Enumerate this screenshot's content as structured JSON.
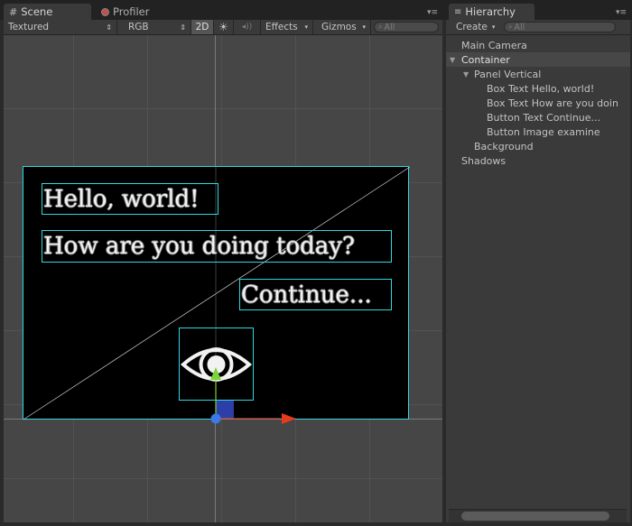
{
  "scene_tabs": [
    {
      "label": "Scene",
      "icon": "grid-icon",
      "active": true
    },
    {
      "label": "Profiler",
      "icon": "profiler-icon",
      "active": false
    }
  ],
  "scene_toolbar": {
    "shading_mode": "Textured",
    "render_mode": "RGB",
    "view_mode": "2D",
    "lighting_icon": "sun-icon",
    "audio_icon": "speaker-icon",
    "effects_label": "Effects",
    "gizmos_label": "Gizmos",
    "search_placeholder": "All"
  },
  "scene_content": {
    "hello_text": "Hello, world!",
    "question_text": "How are you doing today?",
    "continue_text": "Continue...",
    "image_icon": "eye-icon"
  },
  "hierarchy": {
    "tab_label": "Hierarchy",
    "create_label": "Create",
    "search_placeholder": "All",
    "items": [
      {
        "label": "Main Camera",
        "depth": 0,
        "expandable": false
      },
      {
        "label": "Container",
        "depth": 0,
        "expandable": true,
        "selected": true
      },
      {
        "label": "Panel Vertical",
        "depth": 1,
        "expandable": true
      },
      {
        "label": "Box Text Hello, world!",
        "depth": 2,
        "expandable": false
      },
      {
        "label": "Box Text How are you doin",
        "depth": 2,
        "expandable": false
      },
      {
        "label": "Button Text Continue...",
        "depth": 2,
        "expandable": false
      },
      {
        "label": "Button Image examine",
        "depth": 2,
        "expandable": false
      },
      {
        "label": "Background",
        "depth": 1,
        "expandable": false
      },
      {
        "label": "Shadows",
        "depth": 0,
        "expandable": false
      }
    ]
  },
  "colors": {
    "rect_outline": "#2fd8e0",
    "gizmo_x": "#e83a1c",
    "gizmo_y": "#7cd23a",
    "gizmo_z": "#3b7ae8"
  }
}
